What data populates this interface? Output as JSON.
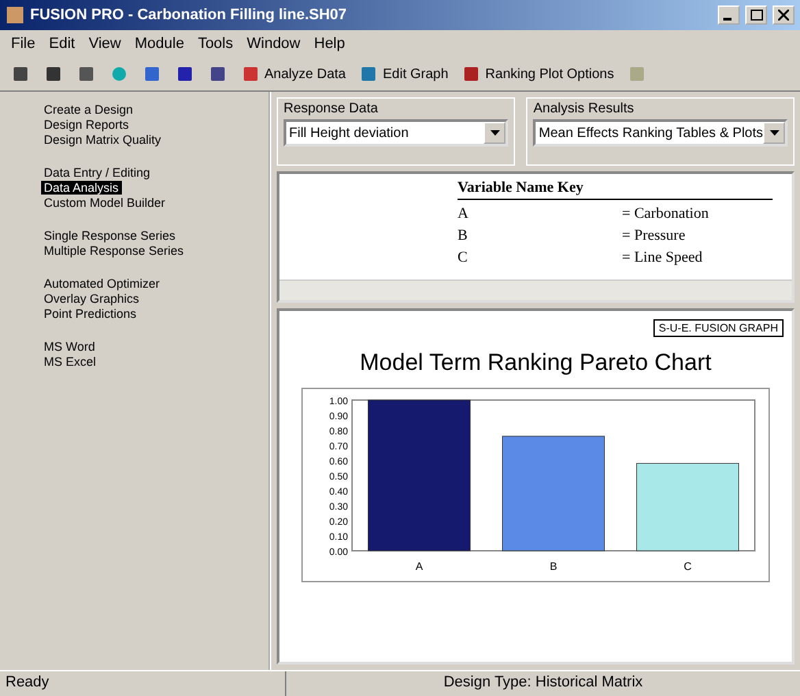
{
  "window": {
    "title": "FUSION PRO - Carbonation Filling line.SH07"
  },
  "menu": [
    "File",
    "Edit",
    "View",
    "Module",
    "Tools",
    "Window",
    "Help"
  ],
  "toolbar": [
    {
      "kind": "icon"
    },
    {
      "kind": "icon"
    },
    {
      "kind": "icon"
    },
    {
      "kind": "icon"
    },
    {
      "kind": "icon"
    },
    {
      "kind": "icon"
    },
    {
      "kind": "icon"
    },
    {
      "kind": "text",
      "label": "Analyze Data"
    },
    {
      "kind": "text",
      "label": "Edit Graph"
    },
    {
      "kind": "text",
      "label": "Ranking Plot Options"
    },
    {
      "kind": "icon"
    }
  ],
  "sidebar": {
    "groups": [
      {
        "items": [
          {
            "label": "Create a Design",
            "selected": false
          },
          {
            "label": "Design Reports",
            "selected": false
          },
          {
            "label": "Design Matrix Quality",
            "selected": false
          }
        ]
      },
      {
        "items": [
          {
            "label": "Data Entry / Editing",
            "selected": false
          },
          {
            "label": "Data Analysis",
            "selected": true
          },
          {
            "label": "Custom Model Builder",
            "selected": false
          }
        ]
      },
      {
        "items": [
          {
            "label": "Single Response Series",
            "selected": false
          },
          {
            "label": "Multiple Response Series",
            "selected": false
          }
        ]
      },
      {
        "items": [
          {
            "label": "Automated Optimizer",
            "selected": false
          },
          {
            "label": "Overlay Graphics",
            "selected": false
          },
          {
            "label": "Point Predictions",
            "selected": false
          }
        ]
      },
      {
        "items": [
          {
            "label": "MS Word",
            "selected": false
          },
          {
            "label": "MS Excel",
            "selected": false
          }
        ]
      }
    ]
  },
  "response_data": {
    "label": "Response Data",
    "value": "Fill Height deviation"
  },
  "analysis_results": {
    "label": "Analysis Results",
    "value": "Mean Effects Ranking Tables & Plots"
  },
  "key_table": {
    "title": "Variable Name Key",
    "rows": [
      {
        "code": "A",
        "name": "= Carbonation"
      },
      {
        "code": "B",
        "name": "= Pressure"
      },
      {
        "code": "C",
        "name": "= Line Speed"
      }
    ]
  },
  "graph": {
    "badge": "S-U-E. FUSION GRAPH",
    "chart_data": {
      "type": "bar",
      "title": "Model Term Ranking Pareto Chart",
      "categories": [
        "A",
        "B",
        "C"
      ],
      "series": [
        {
          "values": [
            1.0,
            0.76,
            0.58
          ]
        }
      ],
      "ylim": [
        0,
        1
      ],
      "yticks": [
        {
          "value": 0,
          "label": "0.00"
        },
        {
          "value": 0.1,
          "label": "0.10"
        },
        {
          "value": 0.2,
          "label": "0.20"
        },
        {
          "value": 0.3,
          "label": "0.30"
        },
        {
          "value": 0.4,
          "label": "0.40"
        },
        {
          "value": 0.5,
          "label": "0.50"
        },
        {
          "value": 0.6,
          "label": "0.60"
        },
        {
          "value": 0.7,
          "label": "0.70"
        },
        {
          "value": 0.8,
          "label": "0.80"
        },
        {
          "value": 0.9,
          "label": "0.90"
        },
        {
          "value": 1,
          "label": "1.00"
        }
      ]
    }
  },
  "status_bar": {
    "left": "Ready",
    "center": "Design Type: Historical Matrix"
  }
}
